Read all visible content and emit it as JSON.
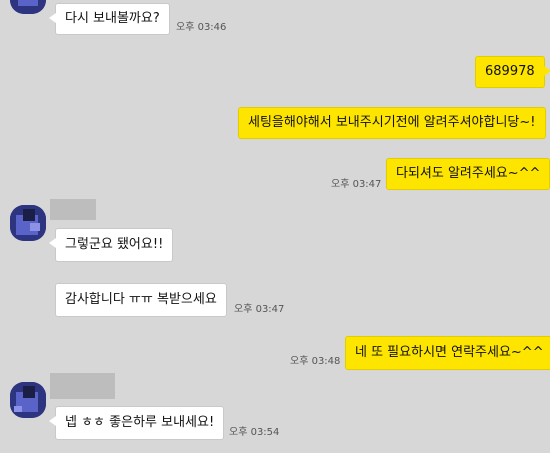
{
  "messages": [
    {
      "text": "다시 보내볼까요?",
      "time": "오후 03:46"
    },
    {
      "text": "689978"
    },
    {
      "text": "세팅을해야해서 보내주시기전에 알려주셔야합니당~!"
    },
    {
      "text": "다되셔도 알려주세요~^^",
      "time": "오후 03:47"
    },
    {
      "text": "그렇군요 됐어요!!"
    },
    {
      "text": "감사합니다 ㅠㅠ 복받으세요",
      "time": "오후 03:47"
    },
    {
      "text": "네 또 필요하시면 연락주세요~^^",
      "time": "오후 03:48"
    },
    {
      "text": "넵 ㅎㅎ 좋은하루 보내세요!",
      "time": "오후 03:54"
    }
  ],
  "colors": {
    "background": "#d7d7d7",
    "outgoing_bubble": "#fee500",
    "incoming_bubble": "#ffffff"
  },
  "icons": {
    "avatar": "avatar-icon"
  }
}
